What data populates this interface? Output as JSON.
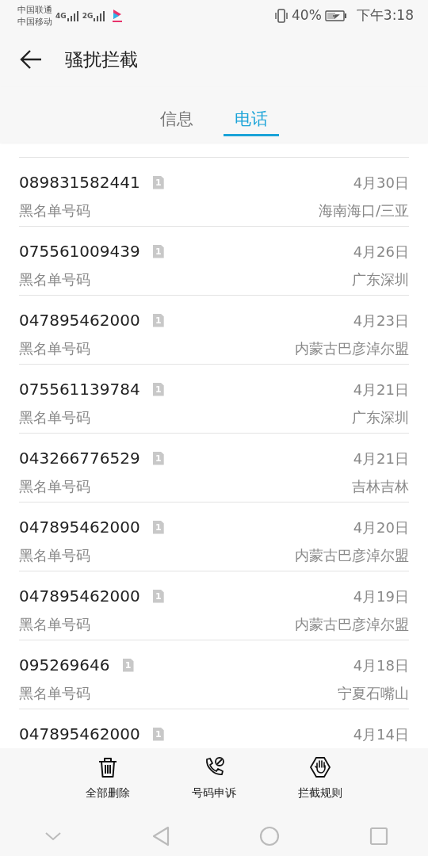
{
  "status_bar": {
    "carriers": [
      "中国联通",
      "中国移动"
    ],
    "networks": [
      "4G",
      "2G"
    ],
    "battery": "40%",
    "time": "下午3:18"
  },
  "header": {
    "title": "骚扰拦截"
  },
  "tabs": [
    {
      "label": "信息",
      "selected": false
    },
    {
      "label": "电话",
      "selected": true
    }
  ],
  "calls": [
    {
      "number": "089831582441",
      "sim": "1",
      "date": "4月30日",
      "label": "黑名单号码",
      "location": "海南海口/三亚"
    },
    {
      "number": "075561009439",
      "sim": "1",
      "date": "4月26日",
      "label": "黑名单号码",
      "location": "广东深圳"
    },
    {
      "number": "047895462000",
      "sim": "1",
      "date": "4月23日",
      "label": "黑名单号码",
      "location": "内蒙古巴彦淖尔盟"
    },
    {
      "number": "075561139784",
      "sim": "1",
      "date": "4月21日",
      "label": "黑名单号码",
      "location": "广东深圳"
    },
    {
      "number": "043266776529",
      "sim": "1",
      "date": "4月21日",
      "label": "黑名单号码",
      "location": "吉林吉林"
    },
    {
      "number": "047895462000",
      "sim": "1",
      "date": "4月20日",
      "label": "黑名单号码",
      "location": "内蒙古巴彦淖尔盟"
    },
    {
      "number": "047895462000",
      "sim": "1",
      "date": "4月19日",
      "label": "黑名单号码",
      "location": "内蒙古巴彦淖尔盟"
    },
    {
      "number": "095269646",
      "sim": "1",
      "date": "4月18日",
      "label": "黑名单号码",
      "location": "宁夏石嘴山"
    },
    {
      "number": "047895462000",
      "sim": "1",
      "date": "4月14日"
    }
  ],
  "toolbar": [
    {
      "kind": "delete",
      "label": "全部删除"
    },
    {
      "kind": "appeal",
      "label": "号码申诉"
    },
    {
      "kind": "rules",
      "label": "拦截规则"
    }
  ]
}
